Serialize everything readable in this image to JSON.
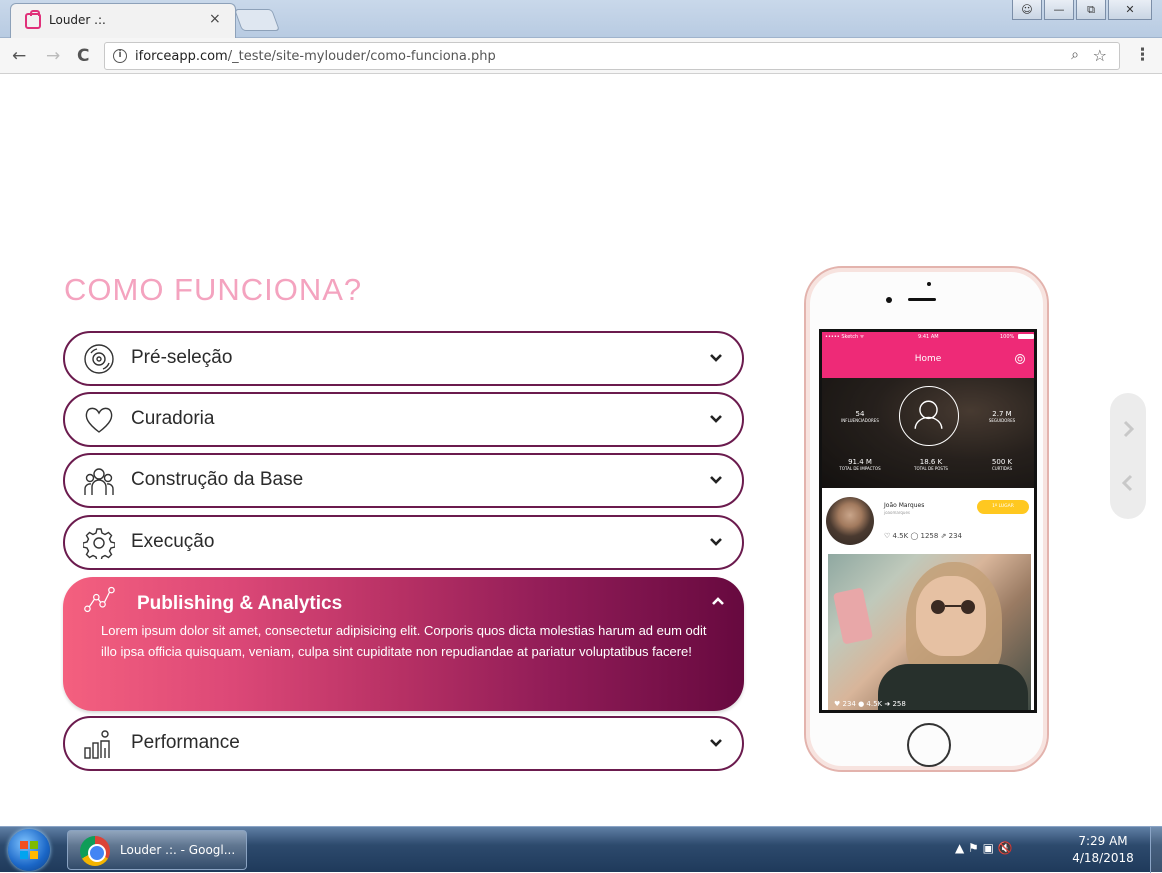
{
  "browser": {
    "tab_title": "Louder .:.",
    "tab_close": "×",
    "url_host": "iforceapp.com",
    "url_path": "/_teste/site-mylouder/como-funciona.php",
    "back": "←",
    "forward": "→",
    "reload": "C",
    "info": "i",
    "zoom_icon": "search-minus-icon",
    "bookmark_icon": "star-icon",
    "menu": "⋮"
  },
  "page": {
    "title": "COMO FUNCIONA?",
    "accent_color": "#f4a3bf",
    "border_color": "#6b1b4e"
  },
  "accordion": [
    {
      "label": "Pré-seleção",
      "icon": "vinyl-icon"
    },
    {
      "label": "Curadoria",
      "icon": "heart-icon"
    },
    {
      "label": "Construção da Base",
      "icon": "group-icon"
    },
    {
      "label": "Execução",
      "icon": "gear-icon"
    }
  ],
  "accordion_open": {
    "label": "Publishing & Analytics",
    "icon": "network-icon",
    "body": "Lorem ipsum dolor sit amet, consectetur adipisicing elit. Corporis quos dicta molestias harum ad eum odit illo ipsa officia quisquam, veniam, culpa sint cupiditate non repudiandae at pariatur voluptatibus facere!"
  },
  "accordion_last": {
    "label": "Performance",
    "icon": "bar-chart-person-icon"
  },
  "phone": {
    "status_left": "••••• Sketch ᯤ",
    "status_time": "9:41 AM",
    "status_right": "100%",
    "app_title": "Home",
    "stats": [
      {
        "num": "54",
        "lbl": "INFLUENCIADORES"
      },
      {
        "num": "2.7 M",
        "lbl": "SEGUIDORES"
      },
      {
        "num": "91.4 M",
        "lbl": "TOTAL DE IMPACTOS"
      },
      {
        "num": "18.6 K",
        "lbl": "TOTAL DE POSTS"
      },
      {
        "num": "500 K",
        "lbl": "CURTIDAS"
      }
    ],
    "post_name": "João Marques",
    "post_handle": "joaomarques",
    "badge": "1º LUGAR",
    "post_stats": "♡ 4.5K  ◯ 1258  ⇗ 234",
    "img_stats": "♥ 234   ● 4.5K   ➜ 258"
  },
  "taskbar": {
    "task_label": "Louder .:. - Googl...",
    "time": "7:29 AM",
    "date": "4/18/2018",
    "tray": "▲   ⚑   ▣   🔇"
  }
}
